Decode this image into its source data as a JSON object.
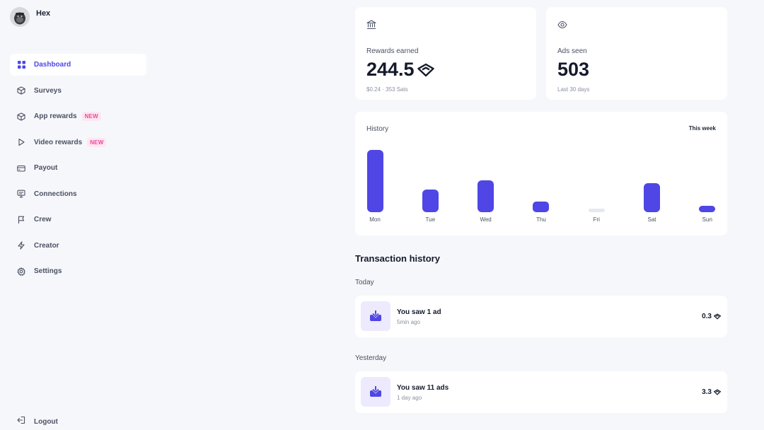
{
  "profile": {
    "name": "Hex",
    "avatar_icon": "gorilla-avatar"
  },
  "sidebar": {
    "items": [
      {
        "label": "Dashboard",
        "icon": "grid-icon",
        "active": true,
        "badge": ""
      },
      {
        "label": "Surveys",
        "icon": "box-icon",
        "active": false,
        "badge": ""
      },
      {
        "label": "App rewards",
        "icon": "box-icon",
        "active": false,
        "badge": "NEW"
      },
      {
        "label": "Video rewards",
        "icon": "play-icon",
        "active": false,
        "badge": "NEW"
      },
      {
        "label": "Payout",
        "icon": "card-icon",
        "active": false,
        "badge": ""
      },
      {
        "label": "Connections",
        "icon": "monitor-icon",
        "active": false,
        "badge": ""
      },
      {
        "label": "Crew",
        "icon": "flag-icon",
        "active": false,
        "badge": ""
      },
      {
        "label": "Creator",
        "icon": "bolt-icon",
        "active": false,
        "badge": ""
      },
      {
        "label": "Settings",
        "icon": "gear-icon",
        "active": false,
        "badge": ""
      }
    ],
    "logout": "Logout"
  },
  "stats": {
    "rewards": {
      "title": "Rewards earned",
      "value": "244.5",
      "sub": "$0.24 · 353 Sats",
      "icon": "bank-icon"
    },
    "ads": {
      "title": "Ads seen",
      "value": "503",
      "sub": "Last 30 days",
      "icon": "eye-icon"
    }
  },
  "history": {
    "title": "History",
    "range": "This week",
    "chart_data": {
      "type": "bar",
      "categories": [
        "Mon",
        "Tue",
        "Wed",
        "Thu",
        "Fri",
        "Sat",
        "Sun"
      ],
      "values": [
        100,
        36,
        51,
        17,
        0,
        47,
        9
      ],
      "ylim": [
        0,
        100
      ]
    }
  },
  "transactions": {
    "title": "Transaction history",
    "groups": [
      {
        "label": "Today",
        "items": [
          {
            "title": "You saw 1 ad",
            "time": "5min ago",
            "amount": "0.3"
          }
        ]
      },
      {
        "label": "Yesterday",
        "items": [
          {
            "title": "You saw 11 ads",
            "time": "1 day ago",
            "amount": "3.3"
          }
        ]
      }
    ]
  },
  "colors": {
    "accent": "#4f46e5",
    "background": "#f6f7fb",
    "badge": "#ec4899"
  }
}
